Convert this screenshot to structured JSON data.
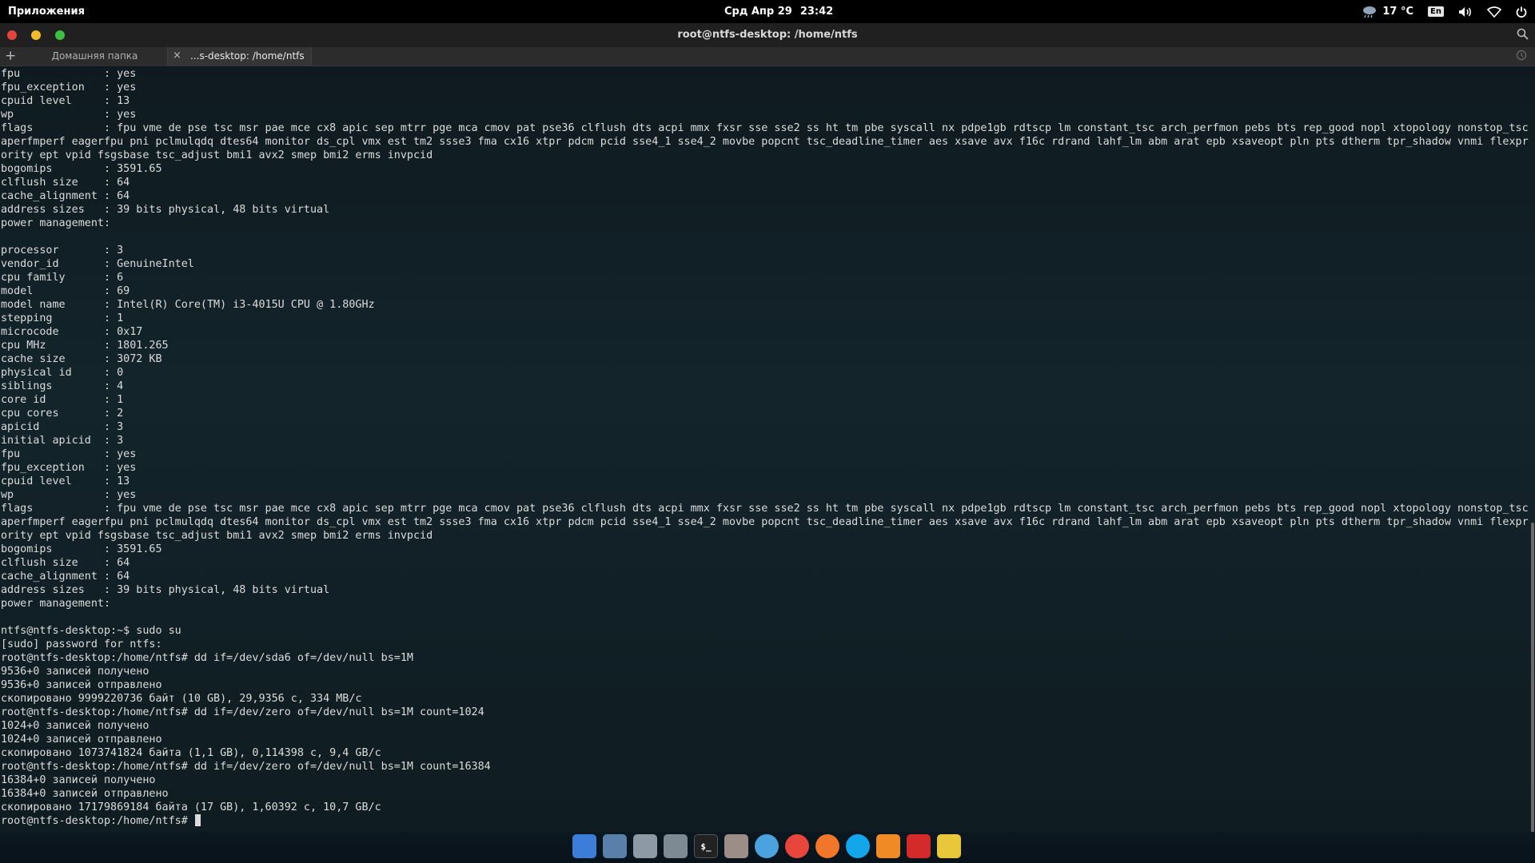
{
  "top_panel": {
    "apps_label": "Приложения",
    "date": "Срд Апр 29",
    "time": "23:42",
    "temperature": "17 °C",
    "keyboard_layout": "En"
  },
  "window": {
    "title": "root@ntfs-desktop: /home/ntfs",
    "tabs": [
      {
        "label": "Домашняя папка",
        "active": false
      },
      {
        "label": "...s-desktop: /home/ntfs",
        "active": true
      }
    ],
    "new_tab_label": "+",
    "tab_close_label": "×"
  },
  "terminal_lines": [
    "fpu             : yes",
    "fpu_exception   : yes",
    "cpuid level     : 13",
    "wp              : yes",
    "flags           : fpu vme de pse tsc msr pae mce cx8 apic sep mtrr pge mca cmov pat pse36 clflush dts acpi mmx fxsr sse sse2 ss ht tm pbe syscall nx pdpe1gb rdtscp lm constant_tsc arch_perfmon pebs bts rep_good nopl xtopology nonstop_tsc",
    "aperfmperf eagerfpu pni pclmulqdq dtes64 monitor ds_cpl vmx est tm2 ssse3 fma cx16 xtpr pdcm pcid sse4_1 sse4_2 movbe popcnt tsc_deadline_timer aes xsave avx f16c rdrand lahf_lm abm arat epb xsaveopt pln pts dtherm tpr_shadow vnmi flexpri",
    "ority ept vpid fsgsbase tsc_adjust bmi1 avx2 smep bmi2 erms invpcid",
    "bogomips        : 3591.65",
    "clflush size    : 64",
    "cache_alignment : 64",
    "address sizes   : 39 bits physical, 48 bits virtual",
    "power management:",
    "",
    "processor       : 3",
    "vendor_id       : GenuineIntel",
    "cpu family      : 6",
    "model           : 69",
    "model name      : Intel(R) Core(TM) i3-4015U CPU @ 1.80GHz",
    "stepping        : 1",
    "microcode       : 0x17",
    "cpu MHz         : 1801.265",
    "cache size      : 3072 KB",
    "physical id     : 0",
    "siblings        : 4",
    "core id         : 1",
    "cpu cores       : 2",
    "apicid          : 3",
    "initial apicid  : 3",
    "fpu             : yes",
    "fpu_exception   : yes",
    "cpuid level     : 13",
    "wp              : yes",
    "flags           : fpu vme de pse tsc msr pae mce cx8 apic sep mtrr pge mca cmov pat pse36 clflush dts acpi mmx fxsr sse sse2 ss ht tm pbe syscall nx pdpe1gb rdtscp lm constant_tsc arch_perfmon pebs bts rep_good nopl xtopology nonstop_tsc",
    "aperfmperf eagerfpu pni pclmulqdq dtes64 monitor ds_cpl vmx est tm2 ssse3 fma cx16 xtpr pdcm pcid sse4_1 sse4_2 movbe popcnt tsc_deadline_timer aes xsave avx f16c rdrand lahf_lm abm arat epb xsaveopt pln pts dtherm tpr_shadow vnmi flexpri",
    "ority ept vpid fsgsbase tsc_adjust bmi1 avx2 smep bmi2 erms invpcid",
    "bogomips        : 3591.65",
    "clflush size    : 64",
    "cache_alignment : 64",
    "address sizes   : 39 bits physical, 48 bits virtual",
    "power management:",
    "",
    "ntfs@ntfs-desktop:~$ sudo su",
    "[sudo] password for ntfs:",
    "root@ntfs-desktop:/home/ntfs# dd if=/dev/sda6 of=/dev/null bs=1M",
    "9536+0 записей получено",
    "9536+0 записей отправлено",
    "скопировано 9999220736 байт (10 GB), 29,9356 c, 334 MB/c",
    "root@ntfs-desktop:/home/ntfs# dd if=/dev/zero of=/dev/null bs=1M count=1024",
    "1024+0 записей получено",
    "1024+0 записей отправлено",
    "скопировано 1073741824 байта (1,1 GB), 0,114398 c, 9,4 GB/c",
    "root@ntfs-desktop:/home/ntfs# dd if=/dev/zero of=/dev/null bs=1M count=16384",
    "16384+0 записей получено",
    "16384+0 записей отправлено",
    "скопировано 17179869184 байта (17 GB), 1,60392 c, 10,7 GB/c"
  ],
  "prompt": "root@ntfs-desktop:/home/ntfs# ",
  "dock_items": [
    {
      "icon": "workspaces-icon",
      "color": "#3b7dd8"
    },
    {
      "icon": "screenshot-icon",
      "color": "#5a7fa8"
    },
    {
      "icon": "switchboard-icon",
      "color": "#8d9aa6"
    },
    {
      "icon": "files-icon",
      "color": "#7d8a93"
    },
    {
      "icon": "terminal-icon",
      "color": "#222222"
    },
    {
      "icon": "software-center-icon",
      "color": "#9c8d86"
    },
    {
      "icon": "midori-browser-icon",
      "color": "#4aa3df"
    },
    {
      "icon": "chrome-icon",
      "color": "#e8453c"
    },
    {
      "icon": "firefox-icon",
      "color": "#f0762a"
    },
    {
      "icon": "skype-icon",
      "color": "#12a7ea"
    },
    {
      "icon": "music-icon",
      "color": "#f08a24"
    },
    {
      "icon": "video-player-icon",
      "color": "#d42a2a"
    },
    {
      "icon": "cartoon-app-icon",
      "color": "#e8c83a"
    }
  ]
}
